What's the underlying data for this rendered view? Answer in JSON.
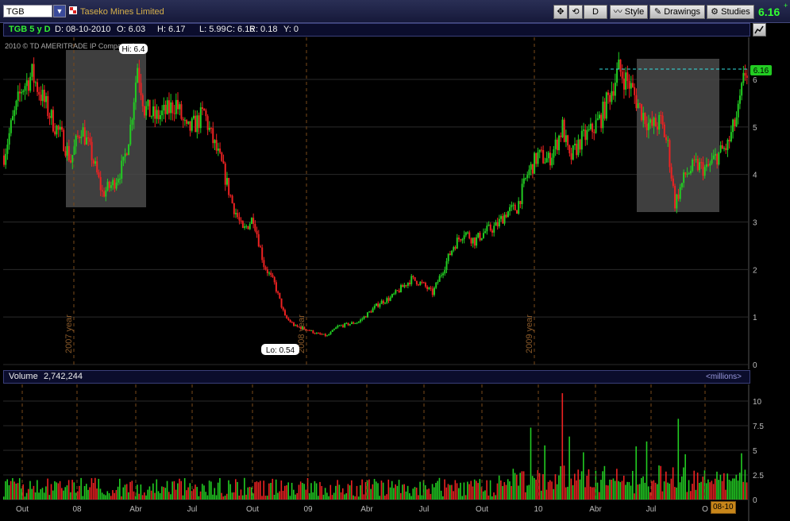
{
  "toolbar": {
    "symbol": "TGB",
    "company": "Taseko Mines Limited",
    "period_button": "D",
    "style_label": "Style",
    "drawings_label": "Drawings",
    "studies_label": "Studies",
    "last_price": "6.16",
    "change_sign": "+"
  },
  "infobar": {
    "symbol_period": "TGB 5 y D",
    "date": "D: 08-10-2010",
    "open": "O: 6.03",
    "high": "H: 6.17",
    "low": "L: 5.99",
    "close": "C: 6.16",
    "range": "R: 0.18",
    "y": "Y: 0"
  },
  "chart": {
    "copyright": "2010 © TD AMERITRADE IP Company, Inc.",
    "hi_label": "Hi: 6.4",
    "lo_label": "Lo: 0.54",
    "price_label": "6.16",
    "year_markers": [
      "2007 year",
      "2008 year",
      "2009 year"
    ]
  },
  "volume": {
    "label": "Volume",
    "value": "2,742,244",
    "units": "<millions>"
  },
  "date_badge": "08-10",
  "colors": {
    "up": "#22cc22",
    "down": "#ee2222",
    "price_tag": "#22cc22",
    "highlight": "#4a4a4a"
  },
  "chart_data": {
    "type": "candlestick",
    "price_axis": {
      "range": [
        0,
        6.5
      ],
      "ticks": [
        "0",
        "1",
        "2",
        "3",
        "4",
        "5",
        "6"
      ]
    },
    "volume_axis": {
      "range": [
        0,
        11
      ],
      "ticks": [
        "0",
        "2.5",
        "5",
        "7.5",
        "10"
      ],
      "units": "millions"
    },
    "x_ticks": [
      "Out",
      "08",
      "Abr",
      "Jul",
      "Out",
      "09",
      "Abr",
      "Jul",
      "Out",
      "10",
      "Abr",
      "Jul",
      "O"
    ],
    "close_path": [
      {
        "x": 0,
        "y": 4.4
      },
      {
        "x": 4,
        "y": 5.0
      },
      {
        "x": 10,
        "y": 5.8
      },
      {
        "x": 16,
        "y": 6.1
      },
      {
        "x": 22,
        "y": 5.6
      },
      {
        "x": 28,
        "y": 5.1
      },
      {
        "x": 34,
        "y": 4.7
      },
      {
        "x": 38,
        "y": 4.3
      },
      {
        "x": 44,
        "y": 5.0
      },
      {
        "x": 50,
        "y": 4.4
      },
      {
        "x": 56,
        "y": 3.6
      },
      {
        "x": 62,
        "y": 3.8
      },
      {
        "x": 68,
        "y": 4.2
      },
      {
        "x": 72,
        "y": 5.0
      },
      {
        "x": 76,
        "y": 6.3
      },
      {
        "x": 80,
        "y": 5.4
      },
      {
        "x": 86,
        "y": 5.2
      },
      {
        "x": 92,
        "y": 5.3
      },
      {
        "x": 98,
        "y": 5.5
      },
      {
        "x": 104,
        "y": 4.9
      },
      {
        "x": 110,
        "y": 5.1
      },
      {
        "x": 114,
        "y": 5.3
      },
      {
        "x": 118,
        "y": 4.8
      },
      {
        "x": 124,
        "y": 4.2
      },
      {
        "x": 130,
        "y": 3.4
      },
      {
        "x": 136,
        "y": 2.8
      },
      {
        "x": 142,
        "y": 3.1
      },
      {
        "x": 148,
        "y": 2.1
      },
      {
        "x": 154,
        "y": 1.7
      },
      {
        "x": 160,
        "y": 1.0
      },
      {
        "x": 166,
        "y": 0.8
      },
      {
        "x": 172,
        "y": 0.75
      },
      {
        "x": 178,
        "y": 0.65
      },
      {
        "x": 184,
        "y": 0.6
      },
      {
        "x": 190,
        "y": 0.8
      },
      {
        "x": 196,
        "y": 0.85
      },
      {
        "x": 202,
        "y": 0.9
      },
      {
        "x": 208,
        "y": 1.1
      },
      {
        "x": 214,
        "y": 1.3
      },
      {
        "x": 220,
        "y": 1.4
      },
      {
        "x": 226,
        "y": 1.6
      },
      {
        "x": 232,
        "y": 1.8
      },
      {
        "x": 238,
        "y": 1.7
      },
      {
        "x": 244,
        "y": 1.5
      },
      {
        "x": 250,
        "y": 2.0
      },
      {
        "x": 256,
        "y": 2.5
      },
      {
        "x": 262,
        "y": 2.8
      },
      {
        "x": 268,
        "y": 2.6
      },
      {
        "x": 274,
        "y": 2.8
      },
      {
        "x": 280,
        "y": 2.9
      },
      {
        "x": 286,
        "y": 3.2
      },
      {
        "x": 292,
        "y": 3.3
      },
      {
        "x": 298,
        "y": 4.0
      },
      {
        "x": 304,
        "y": 4.4
      },
      {
        "x": 310,
        "y": 4.3
      },
      {
        "x": 314,
        "y": 4.6
      },
      {
        "x": 318,
        "y": 5.0
      },
      {
        "x": 322,
        "y": 4.3
      },
      {
        "x": 328,
        "y": 4.7
      },
      {
        "x": 334,
        "y": 4.9
      },
      {
        "x": 340,
        "y": 5.2
      },
      {
        "x": 346,
        "y": 5.8
      },
      {
        "x": 350,
        "y": 6.2
      },
      {
        "x": 356,
        "y": 5.9
      },
      {
        "x": 362,
        "y": 5.4
      },
      {
        "x": 368,
        "y": 5.0
      },
      {
        "x": 374,
        "y": 5.1
      },
      {
        "x": 378,
        "y": 4.6
      },
      {
        "x": 382,
        "y": 3.4
      },
      {
        "x": 388,
        "y": 4.0
      },
      {
        "x": 394,
        "y": 4.2
      },
      {
        "x": 400,
        "y": 4.1
      },
      {
        "x": 406,
        "y": 4.4
      },
      {
        "x": 412,
        "y": 4.6
      },
      {
        "x": 418,
        "y": 5.3
      },
      {
        "x": 422,
        "y": 6.16
      }
    ],
    "volume_spikes": [
      {
        "x": 300,
        "v": 7.3
      },
      {
        "x": 308,
        "v": 5.5
      },
      {
        "x": 318,
        "v": 10.8
      },
      {
        "x": 322,
        "v": 6.4
      },
      {
        "x": 330,
        "v": 4.8
      },
      {
        "x": 360,
        "v": 5.4
      },
      {
        "x": 366,
        "v": 5.9
      },
      {
        "x": 384,
        "v": 8.2
      },
      {
        "x": 388,
        "v": 4.6
      },
      {
        "x": 420,
        "v": 4.7
      }
    ]
  }
}
